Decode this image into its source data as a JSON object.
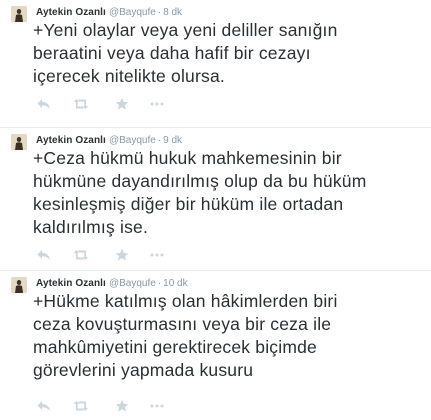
{
  "colors": {
    "text": "#292f33",
    "muted": "#8899a6",
    "action_icon": "#ccd6dd",
    "divider": "#e6ecf0"
  },
  "icons": {
    "reply": "reply-icon",
    "retweet": "retweet-icon",
    "favorite": "star-icon",
    "more": "more-icon"
  },
  "tweets": [
    {
      "fullname": "Aytekin Ozanlı",
      "username": "@Bayqufe",
      "separator": "·",
      "time": "8 dk",
      "text": "+Yeni olaylar veya yeni deliller sanığın\nberaatini veya daha hafif bir cezayı\niçerecek nitelikte olursa."
    },
    {
      "fullname": "Aytekin Ozanlı",
      "username": "@Bayqufe",
      "separator": "·",
      "time": "9 dk",
      "text": "+Ceza hükmü hukuk mahkemesinin bir\nhükmüne dayandırılmış olup da bu hüküm\nkesinleşmiş diğer bir hüküm ile ortadan\nkaldırılmış ise."
    },
    {
      "fullname": "Aytekin Ozanlı",
      "username": "@Bayqufe",
      "separator": "·",
      "time": "10 dk",
      "text": "+Hükme katılmış olan hâkimlerden biri\nceza kovuşturmasını veya bir ceza ile\nmahkûmiyetini gerektirecek biçimde\ngörevlerini yapmada kusuru"
    }
  ]
}
